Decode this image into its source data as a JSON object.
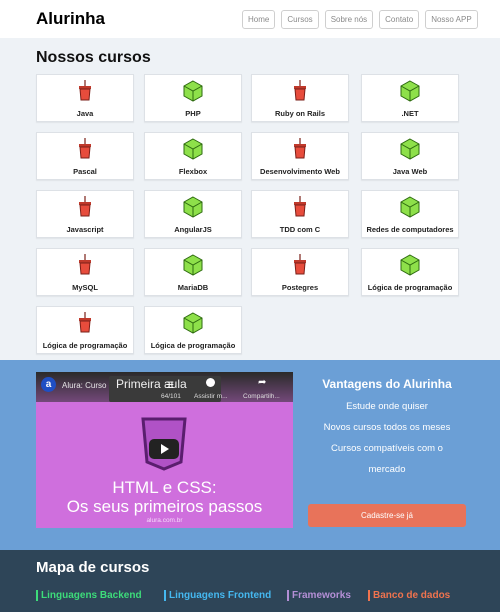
{
  "header": {
    "brand": "Alurinha",
    "nav": [
      "Home",
      "Cursos",
      "Sobre nós",
      "Contato",
      "Nosso APP"
    ]
  },
  "courses": {
    "title": "Nossos cursos",
    "items": [
      {
        "label": "Java",
        "icon": "coffee-cup-icon"
      },
      {
        "label": "PHP",
        "icon": "green-cube-icon"
      },
      {
        "label": "Ruby on Rails",
        "icon": "coffee-cup-icon"
      },
      {
        "label": ".NET",
        "icon": "green-cube-icon"
      },
      {
        "label": "Pascal",
        "icon": "coffee-cup-icon"
      },
      {
        "label": "Flexbox",
        "icon": "green-cube-icon"
      },
      {
        "label": "Desenvolvimento Web",
        "icon": "coffee-cup-icon"
      },
      {
        "label": "Java Web",
        "icon": "green-cube-icon"
      },
      {
        "label": "Javascript",
        "icon": "coffee-cup-icon"
      },
      {
        "label": "AngularJS",
        "icon": "green-cube-icon"
      },
      {
        "label": "TDD com C",
        "icon": "coffee-cup-icon"
      },
      {
        "label": "Redes de computadores",
        "icon": "green-cube-icon"
      },
      {
        "label": "MySQL",
        "icon": "coffee-cup-icon"
      },
      {
        "label": "MariaDB",
        "icon": "green-cube-icon"
      },
      {
        "label": "Postegres",
        "icon": "coffee-cup-icon"
      },
      {
        "label": "Lógica de programação",
        "icon": "green-cube-icon"
      },
      {
        "label": "Lógica de programação",
        "icon": "coffee-cup-icon"
      },
      {
        "label": "Lógica de programação",
        "icon": "green-cube-icon"
      }
    ]
  },
  "video": {
    "channel_logo": "a",
    "title": "Alura: Curso de HTM...",
    "overlay_title": "Primeira aula",
    "counter": "64/101",
    "watch_later": "Assistir m...",
    "share": "Compartilh...",
    "headline_1": "HTML e CSS:",
    "headline_2": "Os seus primeiros passos",
    "site": "alura.com.br"
  },
  "advantages": {
    "title": "Vantagens do Alurinha",
    "items": [
      "Estude onde quiser",
      "Novos cursos todos os meses",
      "Cursos compatíveis com o",
      "mercado"
    ],
    "cta": "Cadastre-se já"
  },
  "map": {
    "title": "Mapa de cursos",
    "links": [
      {
        "label": "Linguagens Backend",
        "color": "#3ddc7a"
      },
      {
        "label": "Linguagens Frontend",
        "color": "#45b8f0"
      },
      {
        "label": "Frameworks",
        "color": "#b48fd6"
      },
      {
        "label": "Banco de dados",
        "color": "#f0734e"
      }
    ]
  },
  "colors": {
    "courses_bg": "#eef2f6",
    "band_bg": "#6b9fd6",
    "cta": "#e8735a",
    "map_bg": "#2e4558"
  }
}
